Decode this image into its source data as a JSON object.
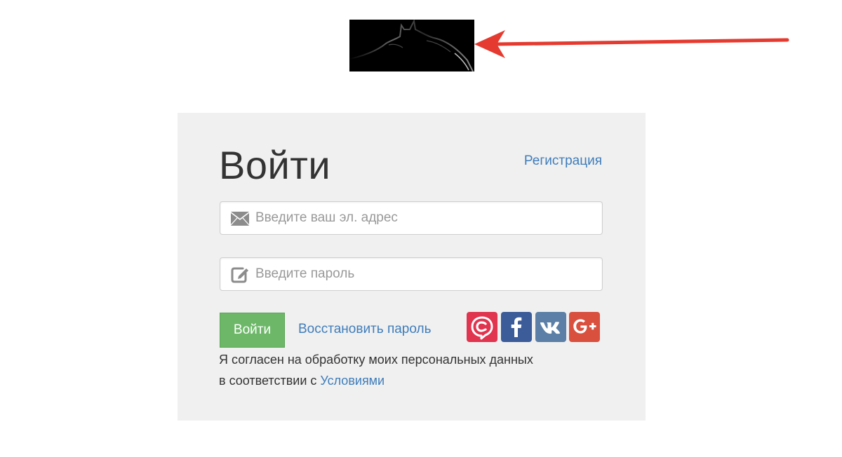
{
  "login": {
    "title": "Войти",
    "register_label": "Регистрация",
    "email_placeholder": "Введите ваш эл. адрес",
    "password_placeholder": "Введите пароль",
    "submit_label": "Войти",
    "restore_label": "Восстановить пароль",
    "consent_line1": "Я согласен на обработку моих персональных данных",
    "consent_line2_prefix": "в соответствии с ",
    "consent_link_label": "Условиями"
  },
  "social": [
    {
      "icon": "copter-icon",
      "color": "#e0344f"
    },
    {
      "icon": "facebook-icon",
      "color": "#3b5b99"
    },
    {
      "icon": "vk-icon",
      "color": "#5b7fa6"
    },
    {
      "icon": "google-plus-icon",
      "color": "#d9503f"
    }
  ],
  "colors": {
    "card_background": "#f0f0f0",
    "link": "#3f7dbb",
    "submit_button": "#6cb868",
    "annotation_arrow": "#e53a2f"
  },
  "icons": {
    "logo": "dark-knight-silhouette-logo",
    "email_field": "envelope-icon",
    "password_field": "edit-icon",
    "annotation": "red-arrow-icon"
  }
}
